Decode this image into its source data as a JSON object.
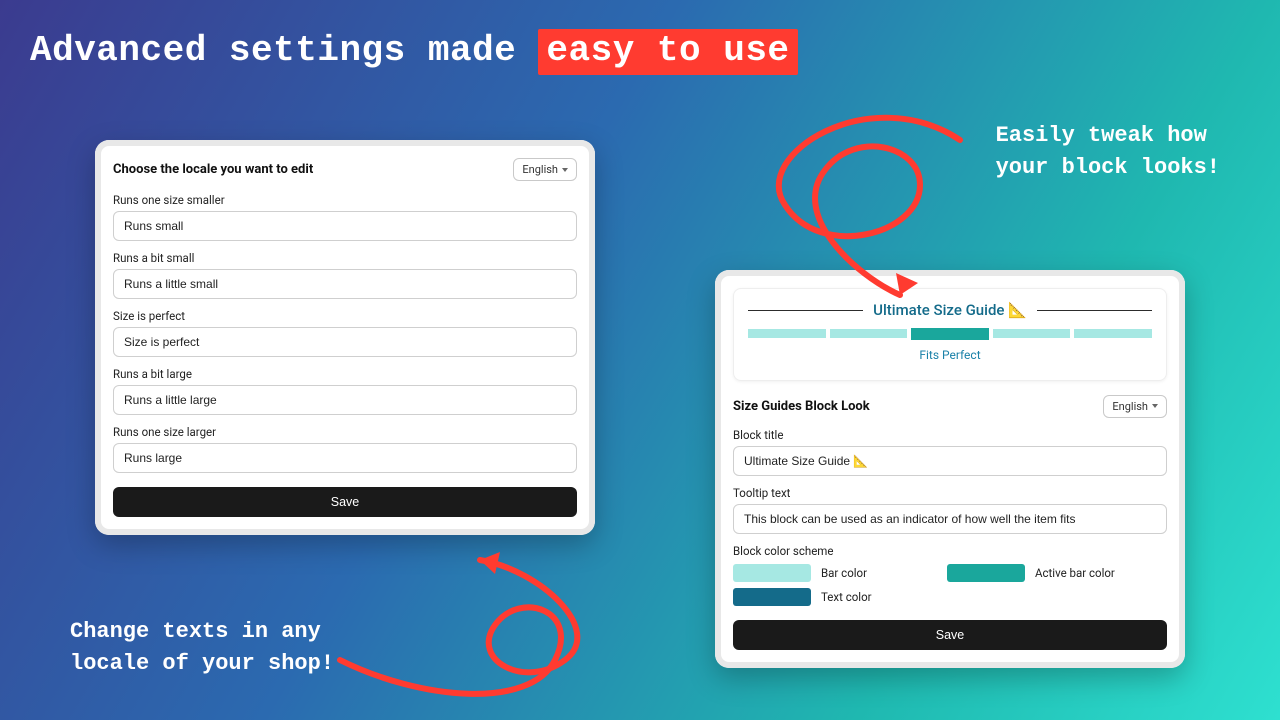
{
  "headline_prefix": "Advanced settings made ",
  "headline_highlight": "easy to use",
  "callouts": {
    "top_right_l1": "Easily tweak how",
    "top_right_l2": "your block looks!",
    "bottom_left_l1": "Change texts in any",
    "bottom_left_l2": "locale of your shop!"
  },
  "left_panel": {
    "title": "Choose the locale you want to edit",
    "lang": "English",
    "fields": [
      {
        "label": "Runs one size smaller",
        "value": "Runs small"
      },
      {
        "label": "Runs a bit small",
        "value": "Runs a little small"
      },
      {
        "label": "Size is perfect",
        "value": "Size is perfect"
      },
      {
        "label": "Runs a bit large",
        "value": "Runs a little large"
      },
      {
        "label": "Runs one size larger",
        "value": "Runs large"
      }
    ],
    "save_label": "Save"
  },
  "right_panel": {
    "preview": {
      "title": "Ultimate Size Guide 📐",
      "fits_label": "Fits Perfect"
    },
    "section_title": "Size Guides Block Look",
    "lang": "English",
    "block_title_label": "Block title",
    "block_title_value": "Ultimate Size Guide 📐",
    "tooltip_label": "Tooltip text",
    "tooltip_value": "This block can be used as an indicator of how well the item fits",
    "scheme_label": "Block color scheme",
    "swatches": {
      "bar_color": {
        "hex": "#a6e8e3",
        "label": "Bar color"
      },
      "active_bar_color": {
        "hex": "#1aa79c",
        "label": "Active bar color"
      },
      "text_color": {
        "hex": "#146b8a",
        "label": "Text color"
      }
    },
    "save_label": "Save"
  },
  "colors": {
    "accent_red": "#ff3b30"
  }
}
